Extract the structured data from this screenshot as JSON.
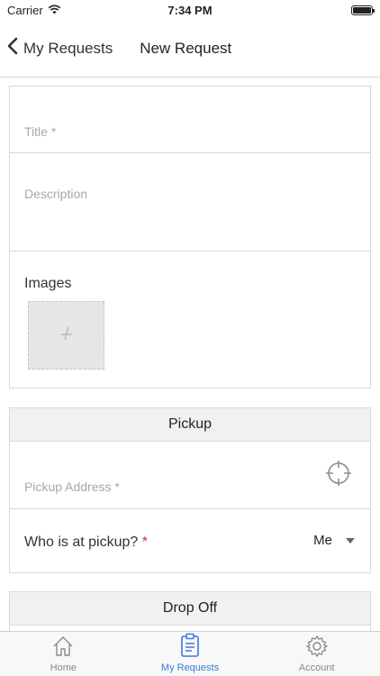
{
  "status_bar": {
    "carrier": "Carrier",
    "time": "7:34 PM"
  },
  "nav": {
    "back_label": "My Requests",
    "title": "New Request"
  },
  "form": {
    "title_placeholder": "Title *",
    "description_placeholder": "Description",
    "images_label": "Images"
  },
  "pickup": {
    "header": "Pickup",
    "address_placeholder": "Pickup Address *",
    "who_label": "Who is at pickup?",
    "who_required": "*",
    "who_value": "Me"
  },
  "dropoff": {
    "header": "Drop Off"
  },
  "tabs": [
    {
      "label": "Home",
      "icon": "home-icon"
    },
    {
      "label": "My Requests",
      "icon": "clipboard-icon"
    },
    {
      "label": "Account",
      "icon": "gear-icon"
    }
  ],
  "colors": {
    "accent": "#3a7bd5",
    "required": "#e12a2a"
  }
}
